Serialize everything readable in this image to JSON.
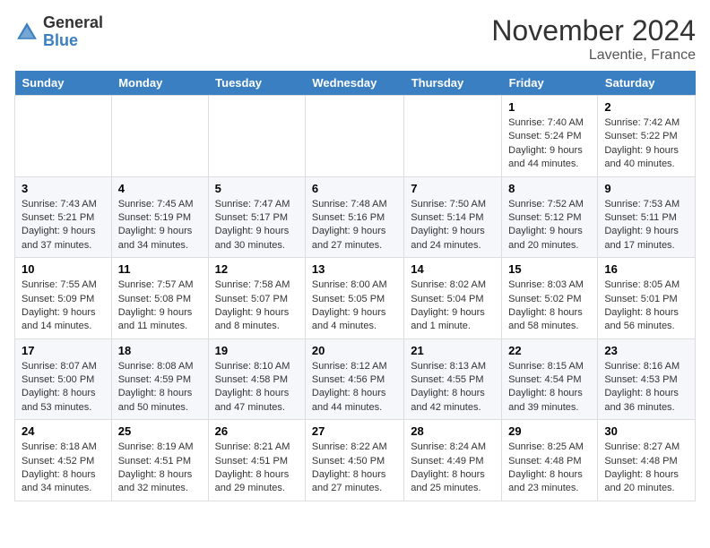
{
  "header": {
    "logo_general": "General",
    "logo_blue": "Blue",
    "month_title": "November 2024",
    "location": "Laventie, France"
  },
  "columns": [
    "Sunday",
    "Monday",
    "Tuesday",
    "Wednesday",
    "Thursday",
    "Friday",
    "Saturday"
  ],
  "weeks": [
    [
      {
        "day": "",
        "info": ""
      },
      {
        "day": "",
        "info": ""
      },
      {
        "day": "",
        "info": ""
      },
      {
        "day": "",
        "info": ""
      },
      {
        "day": "",
        "info": ""
      },
      {
        "day": "1",
        "info": "Sunrise: 7:40 AM\nSunset: 5:24 PM\nDaylight: 9 hours and 44 minutes."
      },
      {
        "day": "2",
        "info": "Sunrise: 7:42 AM\nSunset: 5:22 PM\nDaylight: 9 hours and 40 minutes."
      }
    ],
    [
      {
        "day": "3",
        "info": "Sunrise: 7:43 AM\nSunset: 5:21 PM\nDaylight: 9 hours and 37 minutes."
      },
      {
        "day": "4",
        "info": "Sunrise: 7:45 AM\nSunset: 5:19 PM\nDaylight: 9 hours and 34 minutes."
      },
      {
        "day": "5",
        "info": "Sunrise: 7:47 AM\nSunset: 5:17 PM\nDaylight: 9 hours and 30 minutes."
      },
      {
        "day": "6",
        "info": "Sunrise: 7:48 AM\nSunset: 5:16 PM\nDaylight: 9 hours and 27 minutes."
      },
      {
        "day": "7",
        "info": "Sunrise: 7:50 AM\nSunset: 5:14 PM\nDaylight: 9 hours and 24 minutes."
      },
      {
        "day": "8",
        "info": "Sunrise: 7:52 AM\nSunset: 5:12 PM\nDaylight: 9 hours and 20 minutes."
      },
      {
        "day": "9",
        "info": "Sunrise: 7:53 AM\nSunset: 5:11 PM\nDaylight: 9 hours and 17 minutes."
      }
    ],
    [
      {
        "day": "10",
        "info": "Sunrise: 7:55 AM\nSunset: 5:09 PM\nDaylight: 9 hours and 14 minutes."
      },
      {
        "day": "11",
        "info": "Sunrise: 7:57 AM\nSunset: 5:08 PM\nDaylight: 9 hours and 11 minutes."
      },
      {
        "day": "12",
        "info": "Sunrise: 7:58 AM\nSunset: 5:07 PM\nDaylight: 9 hours and 8 minutes."
      },
      {
        "day": "13",
        "info": "Sunrise: 8:00 AM\nSunset: 5:05 PM\nDaylight: 9 hours and 4 minutes."
      },
      {
        "day": "14",
        "info": "Sunrise: 8:02 AM\nSunset: 5:04 PM\nDaylight: 9 hours and 1 minute."
      },
      {
        "day": "15",
        "info": "Sunrise: 8:03 AM\nSunset: 5:02 PM\nDaylight: 8 hours and 58 minutes."
      },
      {
        "day": "16",
        "info": "Sunrise: 8:05 AM\nSunset: 5:01 PM\nDaylight: 8 hours and 56 minutes."
      }
    ],
    [
      {
        "day": "17",
        "info": "Sunrise: 8:07 AM\nSunset: 5:00 PM\nDaylight: 8 hours and 53 minutes."
      },
      {
        "day": "18",
        "info": "Sunrise: 8:08 AM\nSunset: 4:59 PM\nDaylight: 8 hours and 50 minutes."
      },
      {
        "day": "19",
        "info": "Sunrise: 8:10 AM\nSunset: 4:58 PM\nDaylight: 8 hours and 47 minutes."
      },
      {
        "day": "20",
        "info": "Sunrise: 8:12 AM\nSunset: 4:56 PM\nDaylight: 8 hours and 44 minutes."
      },
      {
        "day": "21",
        "info": "Sunrise: 8:13 AM\nSunset: 4:55 PM\nDaylight: 8 hours and 42 minutes."
      },
      {
        "day": "22",
        "info": "Sunrise: 8:15 AM\nSunset: 4:54 PM\nDaylight: 8 hours and 39 minutes."
      },
      {
        "day": "23",
        "info": "Sunrise: 8:16 AM\nSunset: 4:53 PM\nDaylight: 8 hours and 36 minutes."
      }
    ],
    [
      {
        "day": "24",
        "info": "Sunrise: 8:18 AM\nSunset: 4:52 PM\nDaylight: 8 hours and 34 minutes."
      },
      {
        "day": "25",
        "info": "Sunrise: 8:19 AM\nSunset: 4:51 PM\nDaylight: 8 hours and 32 minutes."
      },
      {
        "day": "26",
        "info": "Sunrise: 8:21 AM\nSunset: 4:51 PM\nDaylight: 8 hours and 29 minutes."
      },
      {
        "day": "27",
        "info": "Sunrise: 8:22 AM\nSunset: 4:50 PM\nDaylight: 8 hours and 27 minutes."
      },
      {
        "day": "28",
        "info": "Sunrise: 8:24 AM\nSunset: 4:49 PM\nDaylight: 8 hours and 25 minutes."
      },
      {
        "day": "29",
        "info": "Sunrise: 8:25 AM\nSunset: 4:48 PM\nDaylight: 8 hours and 23 minutes."
      },
      {
        "day": "30",
        "info": "Sunrise: 8:27 AM\nSunset: 4:48 PM\nDaylight: 8 hours and 20 minutes."
      }
    ]
  ]
}
